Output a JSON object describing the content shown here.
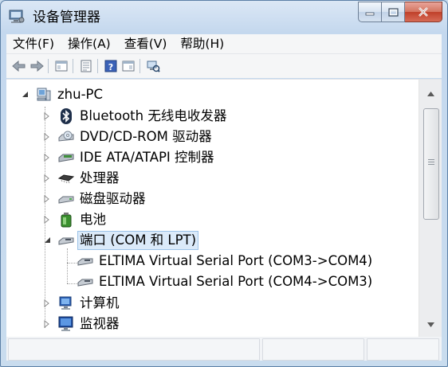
{
  "window": {
    "title": "设备管理器",
    "title_icon": "device-manager-icon"
  },
  "menu": [
    "文件(F)",
    "操作(A)",
    "查看(V)",
    "帮助(H)"
  ],
  "toolbar": {
    "icons": [
      "back-arrow-icon",
      "forward-arrow-icon",
      "show-hide-tree-icon",
      "properties-icon",
      "help-icon",
      "scan-hardware-icon"
    ]
  },
  "tree": {
    "root": "zhu-PC",
    "nodes": [
      {
        "label": "Bluetooth 无线电收发器",
        "icon": "bluetooth-icon"
      },
      {
        "label": "DVD/CD-ROM 驱动器",
        "icon": "dvd-drive-icon"
      },
      {
        "label": "IDE ATA/ATAPI 控制器",
        "icon": "ide-controller-icon"
      },
      {
        "label": "处理器",
        "icon": "processor-icon"
      },
      {
        "label": "磁盘驱动器",
        "icon": "disk-drive-icon"
      },
      {
        "label": "电池",
        "icon": "battery-icon"
      },
      {
        "label": "端口 (COM 和 LPT)",
        "icon": "port-icon",
        "expanded": true,
        "selected": true,
        "children": [
          {
            "label": "ELTIMA Virtual Serial Port (COM3->COM4)",
            "icon": "port-icon"
          },
          {
            "label": "ELTIMA Virtual Serial Port (COM4->COM3)",
            "icon": "port-icon"
          }
        ]
      },
      {
        "label": "计算机",
        "icon": "computer-icon"
      },
      {
        "label": "监视器",
        "icon": "monitor-icon"
      }
    ]
  }
}
